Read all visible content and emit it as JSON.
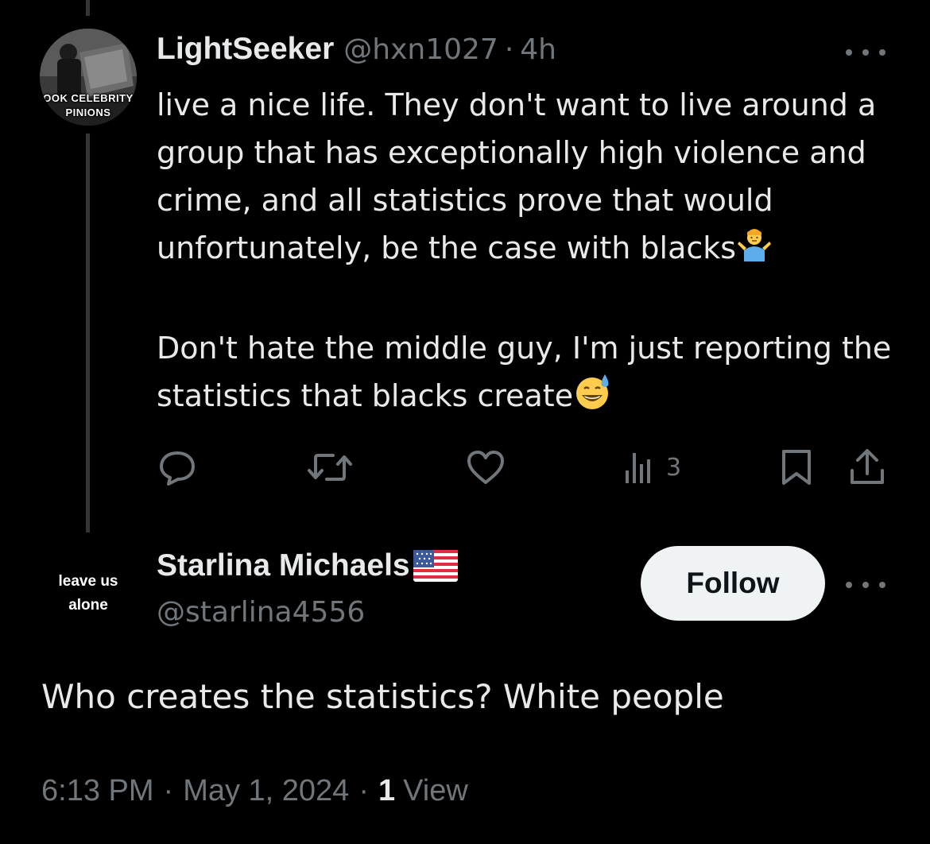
{
  "tweet1": {
    "avatar": {
      "line1": "OOK CELEBRITY",
      "line2": "PINIONS"
    },
    "display_name": "LightSeeker",
    "handle": "@hxn1027",
    "separator": "·",
    "time": "4h",
    "body_paragraph1": "live a nice life. They don't want to live around a group that has exceptionally high violence and crime, and all statistics prove that would unfortunately, be the case with blacks",
    "body_paragraph1_emoji": "person-shrugging-emoji",
    "body_paragraph2": "Don't hate the middle guy, I'm just reporting the statistics that blacks create",
    "body_paragraph2_emoji": "grinning-face-with-sweat-emoji",
    "actions": {
      "views_count": "3"
    },
    "icons": [
      "reply-icon",
      "retweet-icon",
      "heart-icon",
      "views-icon",
      "bookmark-icon",
      "share-icon",
      "more-icon"
    ]
  },
  "tweet2": {
    "avatar": {
      "line1": "leave us",
      "line2": "alone"
    },
    "display_name": "Starlina Michaels",
    "name_emoji": "us-flag-emoji",
    "handle": "@starlina4556",
    "follow_label": "Follow",
    "body": "Who creates the statistics?  White people",
    "meta": {
      "time": "6:13 PM",
      "separator": "·",
      "date": "May 1, 2024",
      "views_count": "1",
      "views_label": "View"
    }
  },
  "colors": {
    "background": "#000000",
    "primary_text": "#e7e9ea",
    "secondary_text": "#71767b",
    "thread_line": "#333639",
    "follow_button_bg": "#eff3f4",
    "follow_button_text": "#0f1419"
  }
}
